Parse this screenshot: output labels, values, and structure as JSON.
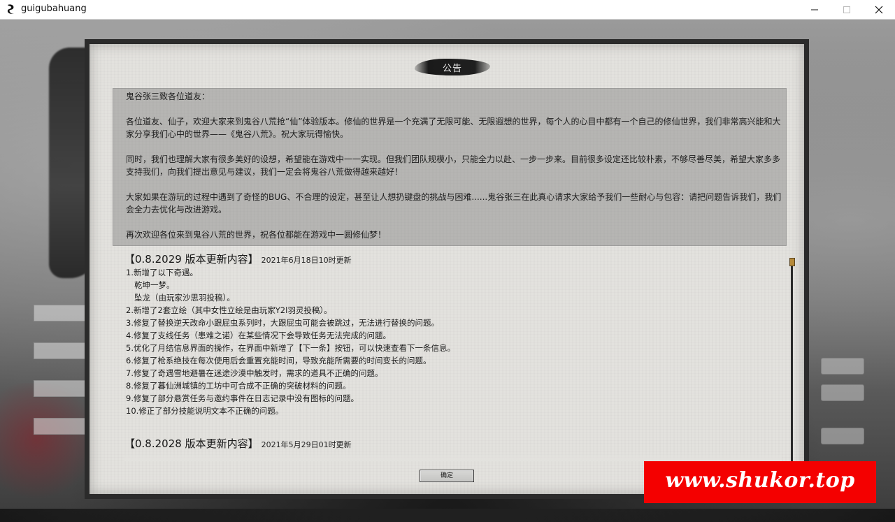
{
  "window": {
    "title": "guigubahuang"
  },
  "dialog": {
    "title": "公告",
    "letter": {
      "greeting": "鬼谷张三致各位道友：",
      "paragraphs": [
        "各位道友、仙子，欢迎大家来到鬼谷八荒抢“仙”体验版本。修仙的世界是一个充满了无限可能、无限遐想的世界，每个人的心目中都有一个自己的修仙世界，我们非常高兴能和大家分享我们心中的世界——《鬼谷八荒》。祝大家玩得愉快。",
        "同时，我们也理解大家有很多美好的设想，希望能在游戏中一一实现。但我们团队规模小，只能全力以赴、一步一步来。目前很多设定还比较朴素，不够尽善尽美，希望大家多多支持我们，向我们提出意见与建议，我们一定会将鬼谷八荒做得越来越好！",
        "大家如果在游玩的过程中遇到了奇怪的BUG、不合理的设定，甚至让人想扔键盘的挑战与困难......鬼谷张三在此真心请求大家给予我们一些耐心与包容：请把问题告诉我们，我们会全力去优化与改进游戏。",
        "再次欢迎各位来到鬼谷八荒的世界，祝各位都能在游戏中一圆修仙梦！"
      ]
    },
    "changelog": [
      {
        "version": "【0.8.2029 版本更新内容】",
        "date": "2021年6月18日10时更新",
        "items": [
          "1.新增了以下奇遇。",
          "乾坤一梦。",
          "坠龙（由玩家沙思羽投稿）。",
          "2.新增了2套立绘（其中女性立绘是由玩家Y2l羽灵投稿）。",
          "3.修复了替换逆天改命小跟屁虫系列时，大跟屁虫可能会被跳过，无法进行替换的问题。",
          "4.修复了支线任务（患难之诺）在某些情况下会导致任务无法完成的问题。",
          "5.优化了月结信息界面的操作，在界面中新增了【下一条】按钮，可以快速查看下一条信息。",
          "6.修复了枪系绝技在每次使用后会重置充能时间，导致充能所需要的时间变长的问题。",
          "7.修复了奇遇雪地避暑在迷途沙漠中触发时，需求的道具不正确的问题。",
          "8.修复了暮仙洲城镇的工坊中可合成不正确的突破材料的问题。",
          "9.修复了部分悬赏任务与邀约事件在日志记录中没有图标的问题。",
          "10.修正了部分技能说明文本不正确的问题。"
        ]
      },
      {
        "version": "【0.8.2028 版本更新内容】",
        "date": "2021年5月29日01时更新",
        "items": []
      }
    ],
    "confirm_label": "确定"
  },
  "watermark": {
    "text": "www.shukor.top"
  },
  "colors": {
    "paper": "#e3e2de",
    "frame": "#2b2b2b",
    "scroll_thumb": "#b68a3a",
    "watermark_bg": "#f40000"
  }
}
